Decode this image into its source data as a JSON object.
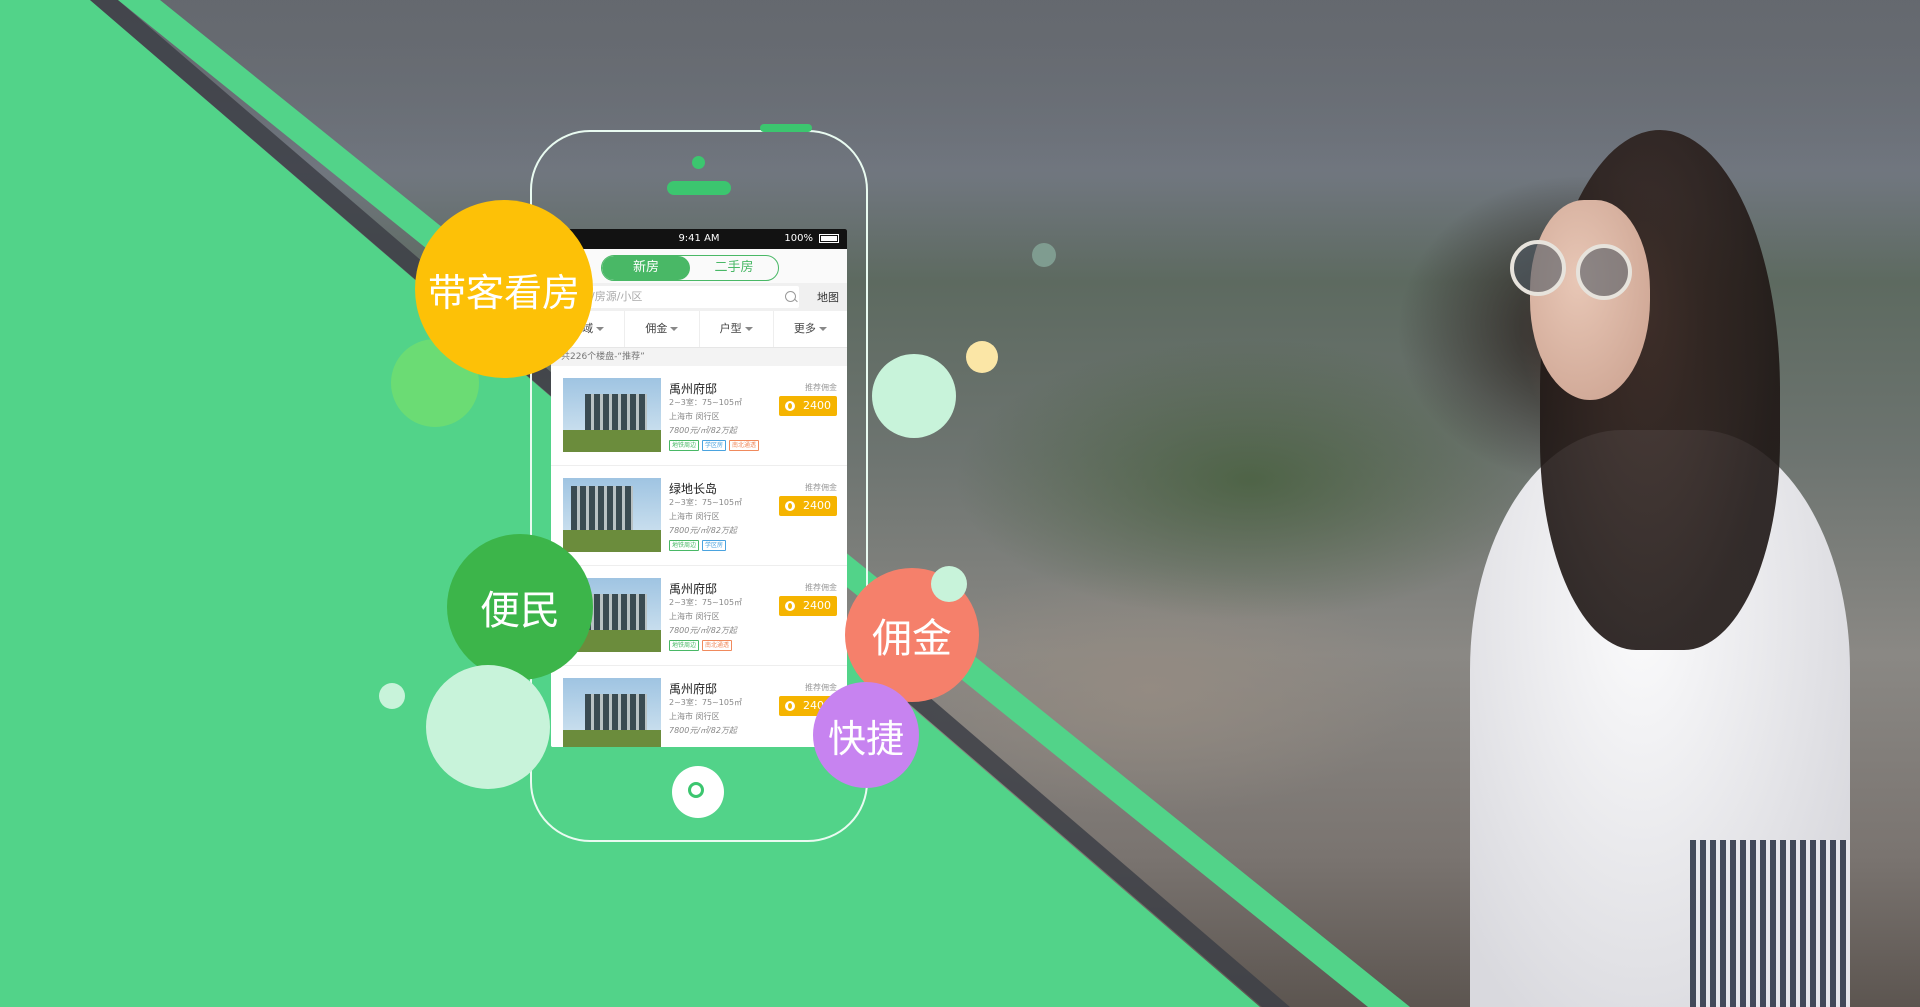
{
  "phone": {
    "status_time": "9:41 AM",
    "battery": "100%",
    "tabs": [
      {
        "label": "新房",
        "active": true
      },
      {
        "label": "二手房",
        "active": false
      }
    ],
    "search": {
      "placeholder": "商品/房源/小区",
      "map_label": "地图"
    },
    "filters": [
      "区域",
      "佣金",
      "户型",
      "更多"
    ],
    "result_summary": "共226个楼盘-“推荐”",
    "commission_label": "推荐佣金",
    "listings": [
      {
        "name": "禹州府邸",
        "spec": "2~3室：75~105㎡",
        "location": "上海市 闵行区",
        "price": "7800元/㎡/82万起",
        "commission": "2400",
        "tags": [
          {
            "text": "地铁周边",
            "color": "green"
          },
          {
            "text": "学区房",
            "color": "blue"
          },
          {
            "text": "南北通透",
            "color": "orange"
          }
        ]
      },
      {
        "name": "绿地长岛",
        "spec": "2~3室：75~105㎡",
        "location": "上海市 闵行区",
        "price": "7800元/㎡/82万起",
        "commission": "2400",
        "tags": [
          {
            "text": "地铁周边",
            "color": "green"
          },
          {
            "text": "学区房",
            "color": "blue"
          }
        ]
      },
      {
        "name": "禹州府邸",
        "spec": "2~3室：75~105㎡",
        "location": "上海市 闵行区",
        "price": "7800元/㎡/82万起",
        "commission": "2400",
        "tags": [
          {
            "text": "地铁周边",
            "color": "green"
          },
          {
            "text": "南北通透",
            "color": "orange"
          }
        ]
      },
      {
        "name": "禹州府邸",
        "spec": "2~3室：75~105㎡",
        "location": "上海市 闵行区",
        "price": "7800元/㎡/82万起",
        "commission": "2400",
        "tags": []
      }
    ]
  },
  "bubbles": {
    "dai_ke": "带客看房",
    "bian_min": "便民",
    "yong_jin": "佣金",
    "kuai_jie": "快捷"
  },
  "colors": {
    "brand_green": "#52d389",
    "stripe_dark": "#3d3f47",
    "bubble_yellow": "#fdc107",
    "bubble_green": "#3cb54a",
    "bubble_salmon": "#f5806b",
    "bubble_purple": "#c783f0",
    "light_mint": "#c8f3da",
    "light_lime": "#6bdc74"
  }
}
